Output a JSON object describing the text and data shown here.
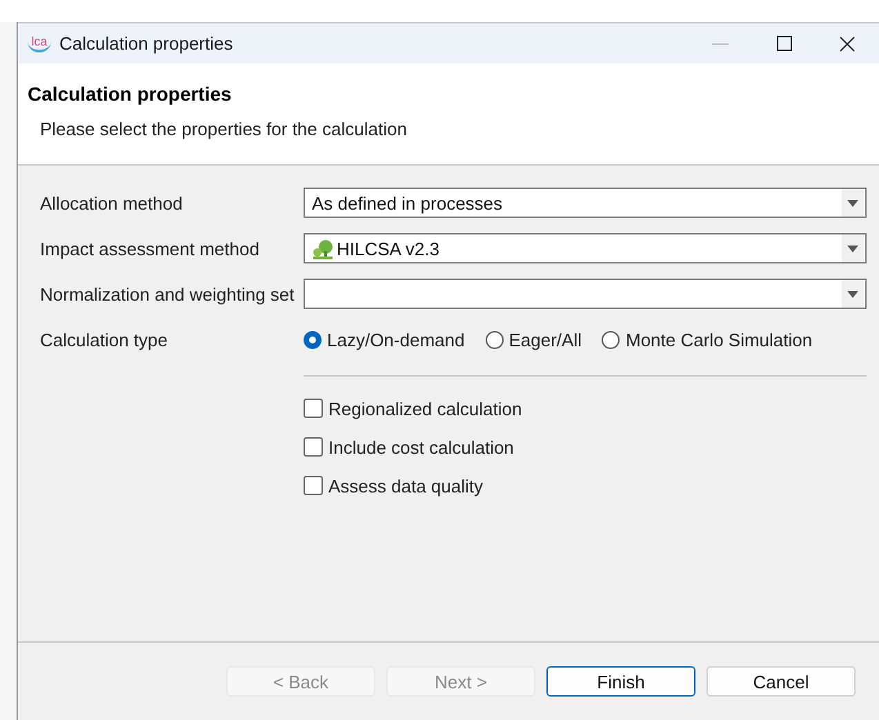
{
  "window": {
    "title": "Calculation properties",
    "logo": "lca"
  },
  "header": {
    "title": "Calculation properties",
    "description": "Please select the properties for the calculation"
  },
  "fields": [
    {
      "label": "Allocation method",
      "value": "As defined in processes",
      "has_icon": false
    },
    {
      "label": "Impact assessment method",
      "value": "HILCSA v2.3",
      "has_icon": true
    },
    {
      "label": "Normalization and weighting set",
      "has_icon": false
    }
  ],
  "calculation_type": {
    "label": "Calculation type",
    "options": [
      {
        "label": "Lazy/On-demand",
        "selected": true
      },
      {
        "label": "Eager/All",
        "selected": false
      },
      {
        "label": "Monte Carlo Simulation",
        "selected": false
      }
    ]
  },
  "options": [
    {
      "label": "Regionalized calculation",
      "checked": false
    },
    {
      "label": "Include cost calculation",
      "checked": false
    },
    {
      "label": "Assess data quality",
      "checked": false
    }
  ],
  "buttons": [
    {
      "label": "< Back",
      "disabled": true,
      "default": false
    },
    {
      "label": "Next >",
      "disabled": true,
      "default": false
    },
    {
      "label": "Finish",
      "disabled": false,
      "default": true
    },
    {
      "label": "Cancel",
      "disabled": false,
      "default": false
    }
  ]
}
